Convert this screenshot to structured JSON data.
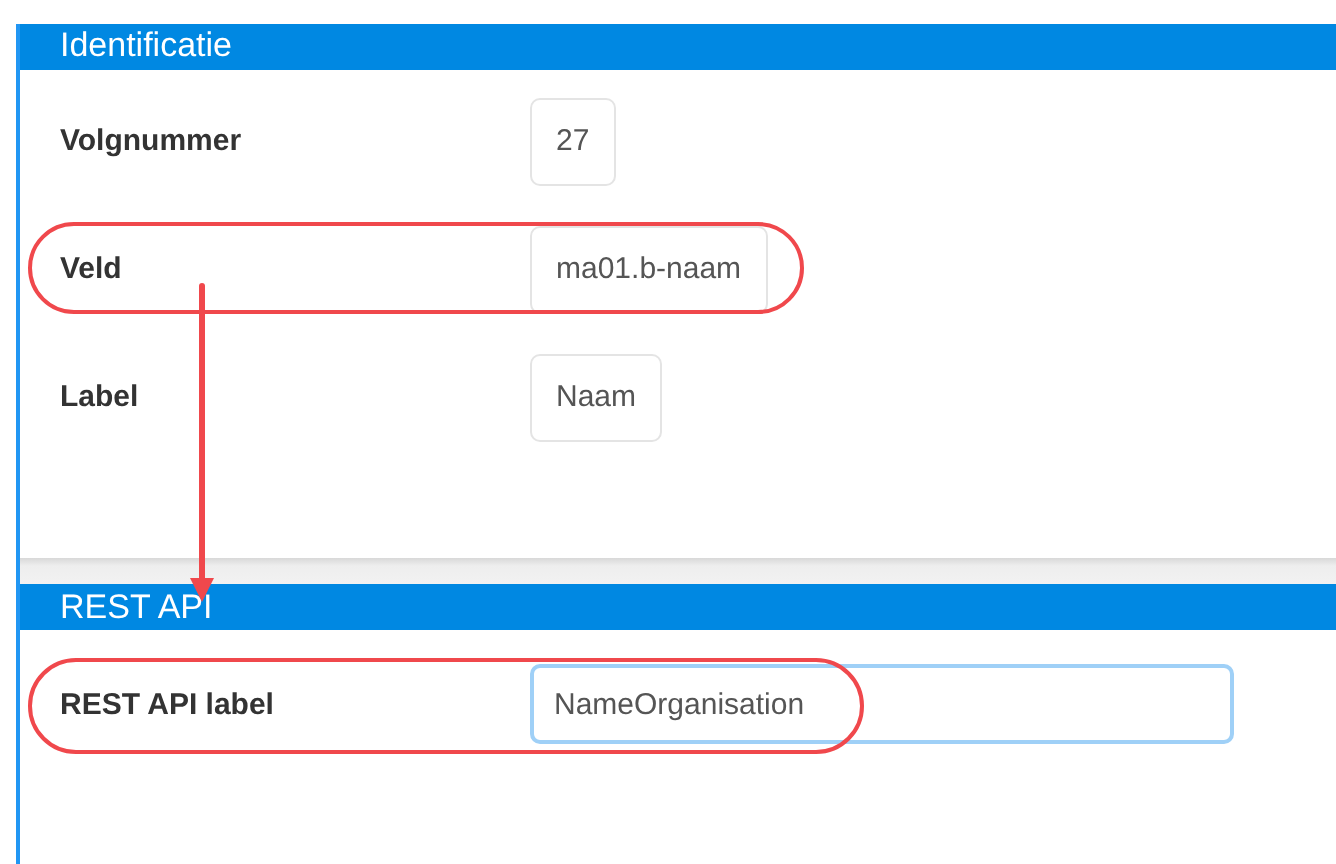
{
  "sections": [
    {
      "title": "Identificatie",
      "rows": [
        {
          "label": "Volgnummer",
          "value": "27",
          "focused": false,
          "highlighted": false
        },
        {
          "label": "Veld",
          "value": "ma01.b-naam",
          "focused": false,
          "highlighted": true
        },
        {
          "label": "Label",
          "value": "Naam",
          "focused": false,
          "highlighted": false
        }
      ]
    },
    {
      "title": "REST API",
      "rows": [
        {
          "label": "REST API label",
          "value": "NameOrganisation",
          "focused": true,
          "highlighted": true
        }
      ]
    }
  ]
}
